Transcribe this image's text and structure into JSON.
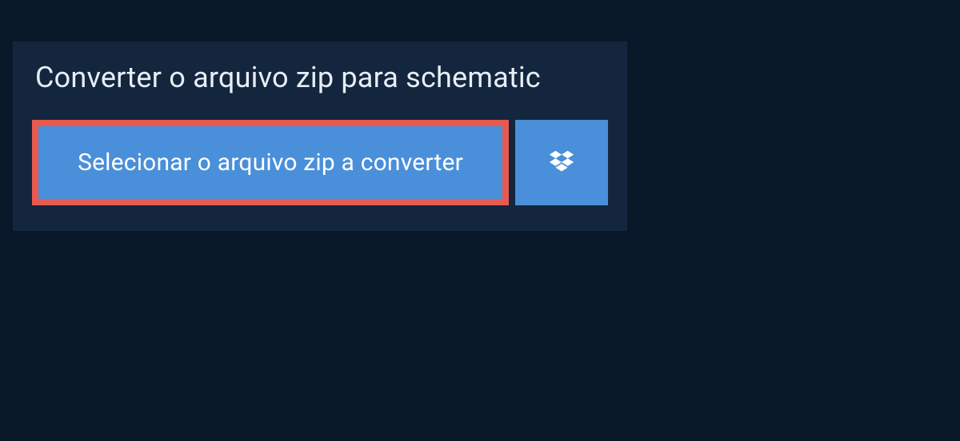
{
  "header": {
    "title": "Converter o arquivo zip para schematic"
  },
  "buttons": {
    "select_file_label": "Selecionar o arquivo zip a converter"
  }
}
